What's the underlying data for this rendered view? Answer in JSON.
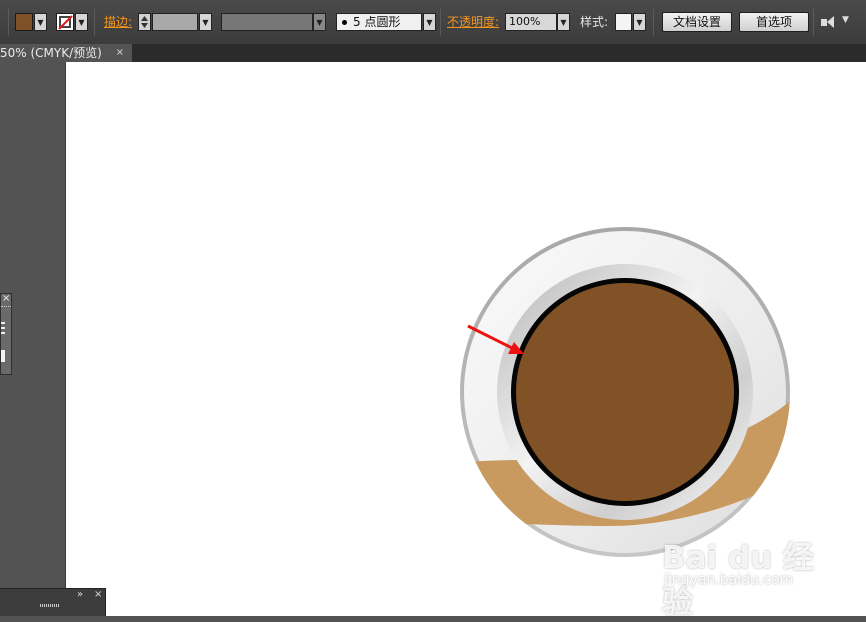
{
  "controlbar": {
    "stroke_label": "描边:",
    "brush_value": "5 点圆形",
    "opacity_label": "不透明度:",
    "opacity_value": "100%",
    "style_label": "样式:",
    "doc_setup_button": "文档设置",
    "preferences_button": "首选项"
  },
  "document_tab": {
    "title": "50% (CMYK/预览)",
    "close": "×"
  },
  "panels": {
    "panel1_close": "×",
    "panel2_close": "×",
    "panel2_expand": "»"
  },
  "colors": {
    "fill": "#7f5127",
    "coffee": "#805225",
    "saucer_band": "#c89a5f",
    "annotation_arrow": "#ee1111"
  },
  "watermark": {
    "brand": "Bai du 经验",
    "site": "jingyan.baidu.com"
  },
  "icons": [
    "fill-swatch-icon",
    "no-stroke-icon",
    "brush-dot-icon",
    "chevron-down-icon",
    "arrange-icon",
    "red-arrow-icon",
    "paw-icon"
  ]
}
